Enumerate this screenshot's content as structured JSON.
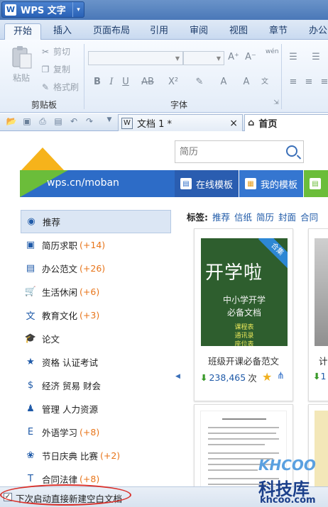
{
  "app": {
    "logo_letter": "W",
    "title": "WPS 文字",
    "menu_arrow": "▾"
  },
  "ribbon_tabs": [
    "开始",
    "插入",
    "页面布局",
    "引用",
    "审阅",
    "视图",
    "章节",
    "办公"
  ],
  "ribbon": {
    "paste_label": "粘贴",
    "cut_label": "剪切",
    "copy_label": "复制",
    "format_painter_label": "格式刷",
    "clipboard_group": "剪贴板",
    "font_group": "字体",
    "font_buttons": [
      "B",
      "I",
      "U",
      "AB",
      "X²",
      "A",
      "A"
    ],
    "grow_font": "A⁺",
    "shrink_font": "A⁻",
    "wen_label": "wén"
  },
  "quickbar": {
    "doc_tab_label": "文档 1 *",
    "doc_tab_close": "×",
    "home_tab_label": "首页"
  },
  "home": {
    "site_url": "wps.cn/moban",
    "search_placeholder": "简历",
    "nav_online": "在线模板",
    "nav_mine": "我的模板",
    "tags_label": "标签:",
    "tags": [
      "推荐",
      "信纸",
      "简历",
      "封面",
      "合同"
    ],
    "sidebar": [
      {
        "label": "推荐",
        "count": "",
        "icon": "circle-icon"
      },
      {
        "label": "简历求职",
        "count": "(+14)",
        "icon": "resume-icon"
      },
      {
        "label": "办公范文",
        "count": "(+26)",
        "icon": "document-icon"
      },
      {
        "label": "生活休闲",
        "count": "(+6)",
        "icon": "cart-icon"
      },
      {
        "label": "教育文化",
        "count": "(+3)",
        "icon": "culture-icon"
      },
      {
        "label": "论文",
        "count": "",
        "icon": "graduation-cap-icon"
      },
      {
        "label": "资格 认证考试",
        "count": "",
        "icon": "certificate-icon"
      },
      {
        "label": "经济 贸易 财会",
        "count": "",
        "icon": "dollar-icon"
      },
      {
        "label": "管理 人力资源",
        "count": "",
        "icon": "people-icon"
      },
      {
        "label": "外语学习",
        "count": "(+8)",
        "icon": "language-icon"
      },
      {
        "label": "节日庆典 比赛",
        "count": "(+2)",
        "icon": "balloon-icon"
      },
      {
        "label": "合同法律",
        "count": "(+8)",
        "icon": "contract-icon"
      }
    ],
    "card1": {
      "badge": "合集",
      "thumb_big": "开学啦",
      "thumb_sub1": "中小学开学",
      "thumb_sub2": "必备文档",
      "thumb_small": [
        "课程表",
        "通讯录",
        "座位表"
      ],
      "title": "班级开课必备范文",
      "downloads": "238,465",
      "downloads_unit": "次"
    },
    "card2": {
      "title_partial": "计",
      "downloads_partial": "1"
    }
  },
  "footer": {
    "checkbox_checked": true,
    "checkbox_mark": "✓",
    "label": "下次启动直接新建空白文档"
  },
  "watermark": {
    "brand": "KHCOO",
    "cn": "科技库",
    "url": "khcoo.com"
  },
  "colors": {
    "accent": "#2d6cc7",
    "count": "#e8751a",
    "highlight_circle": "#d9302a"
  }
}
